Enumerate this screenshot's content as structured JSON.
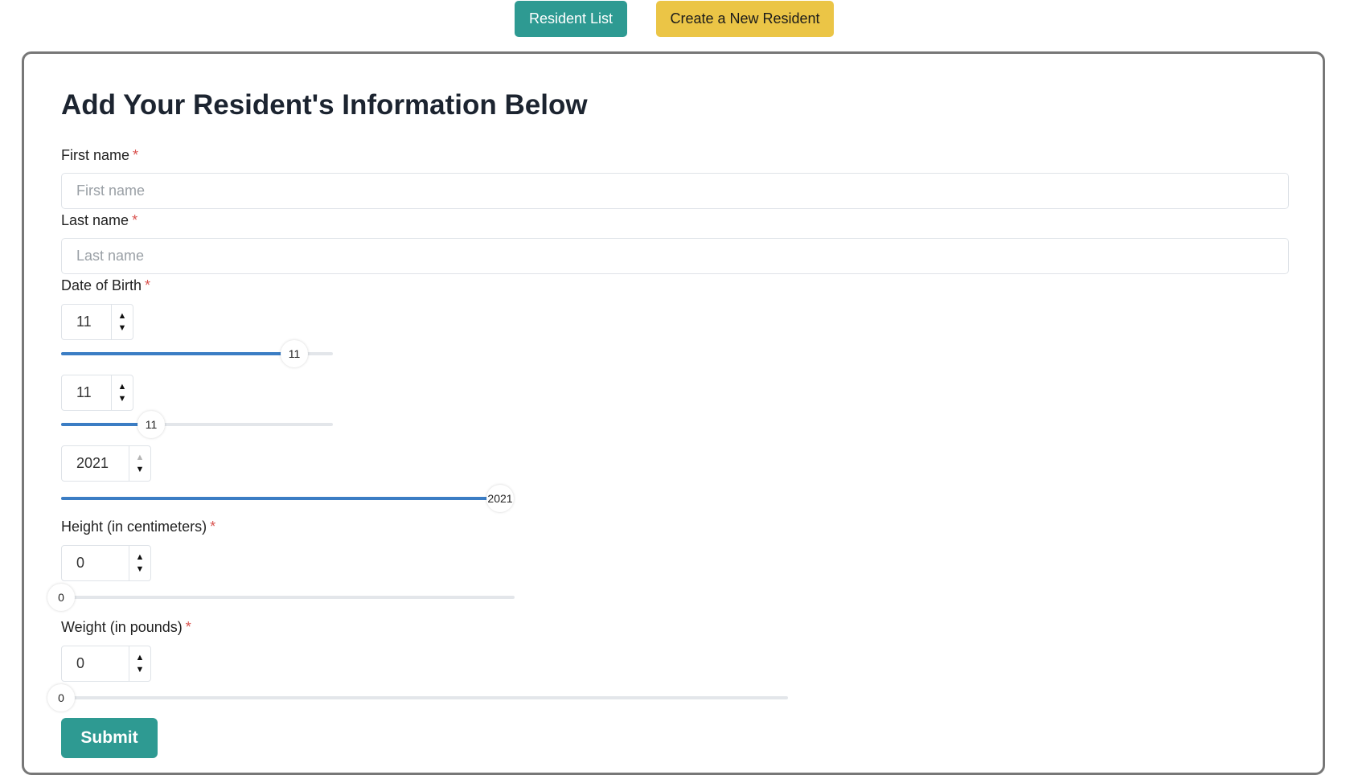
{
  "nav": {
    "resident_list": "Resident List",
    "create_new": "Create a New Resident"
  },
  "form": {
    "title": "Add Your Resident's Information Below",
    "required_mark": "*",
    "first_name": {
      "label": "First name",
      "placeholder": "First name",
      "value": ""
    },
    "last_name": {
      "label": "Last name",
      "placeholder": "Last name",
      "value": ""
    },
    "dob": {
      "label": "Date of Birth",
      "month": {
        "value": "11",
        "slider_value": "11",
        "level": 0.857
      },
      "day": {
        "value": "11",
        "slider_value": "11",
        "level": 0.33
      },
      "year": {
        "value": "2021",
        "slider_value": "2021",
        "level": 1.0
      }
    },
    "height": {
      "label": "Height (in centimeters)",
      "value": "0",
      "slider_value": "0",
      "level": 0
    },
    "weight": {
      "label": "Weight (in pounds)",
      "value": "0",
      "slider_value": "0",
      "level": 0
    },
    "submit": "Submit"
  },
  "icons": {
    "up": "spin-up-icon",
    "down": "spin-down-icon"
  },
  "colors": {
    "teal": "#2e9a92",
    "yellow": "#ebc546",
    "slider_blue": "#3b7dc4",
    "required_red": "#d9534f"
  }
}
